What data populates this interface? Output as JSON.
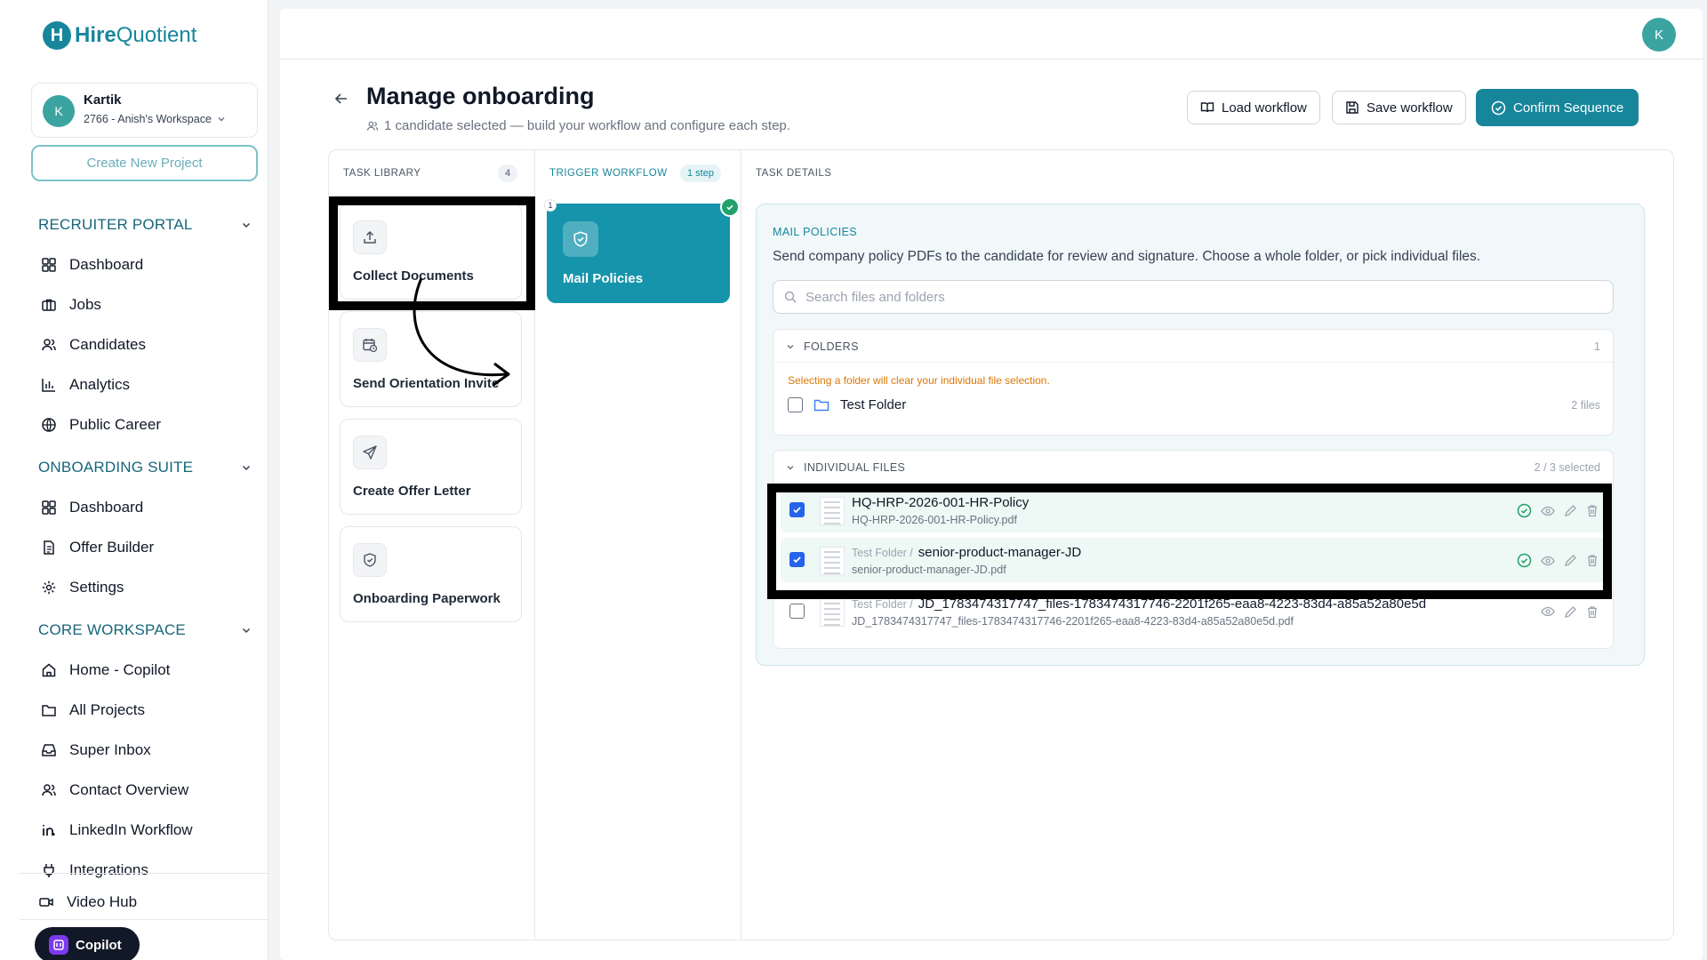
{
  "brand": {
    "logo_letter": "H",
    "name_bold": "Hire",
    "name_light": "Quotient",
    "color": "#17869b"
  },
  "workspace": {
    "avatar": "K",
    "user": "Kartik",
    "name": "2766 - Anish's Workspace"
  },
  "sidebar": {
    "create_project": "Create New Project",
    "sections": [
      {
        "title": "RECRUITER PORTAL",
        "items": [
          "Dashboard",
          "Jobs",
          "Candidates",
          "Analytics",
          "Public Career"
        ]
      },
      {
        "title": "ONBOARDING SUITE",
        "items": [
          "Dashboard",
          "Offer Builder",
          "Settings"
        ]
      },
      {
        "title": "CORE WORKSPACE",
        "items": [
          "Home - Copilot",
          "All Projects",
          "Super Inbox",
          "Contact Overview",
          "LinkedIn Workflow",
          "Integrations"
        ]
      }
    ],
    "video_hub": "Video Hub",
    "copilot": "Copilot"
  },
  "header": {
    "avatar": "K"
  },
  "page": {
    "title": "Manage onboarding",
    "subtitle": "1 candidate selected — build your workflow and configure each step.",
    "load_workflow": "Load workflow",
    "save_workflow": "Save workflow",
    "confirm_sequence": "Confirm Sequence"
  },
  "task_library": {
    "title": "TASK LIBRARY",
    "count": "4",
    "tasks": [
      "Collect Documents",
      "Send Orientation Invite",
      "Create Offer Letter",
      "Onboarding Paperwork"
    ]
  },
  "trigger": {
    "title": "TRIGGER WORKFLOW",
    "steps_badge": "1 step",
    "step_number": "1",
    "step_label": "Mail Policies"
  },
  "details": {
    "title": "TASK DETAILS",
    "panel_title": "MAIL POLICIES",
    "description": "Send company policy PDFs to the candidate for review and signature. Choose a whole folder, or pick individual files.",
    "search_placeholder": "Search files and folders",
    "folders": {
      "title": "FOLDERS",
      "count": "1",
      "warning": "Selecting a folder will clear your individual file selection.",
      "items": [
        {
          "name": "Test Folder",
          "meta": "2 files",
          "checked": false
        }
      ]
    },
    "files": {
      "title": "INDIVIDUAL FILES",
      "count": "2 / 3 selected",
      "items": [
        {
          "folder": "",
          "name": "HQ-HRP-2026-001-HR-Policy",
          "file": "HQ-HRP-2026-001-HR-Policy.pdf",
          "checked": true
        },
        {
          "folder": "Test Folder /",
          "name": "senior-product-manager-JD",
          "file": "senior-product-manager-JD.pdf",
          "checked": true
        },
        {
          "folder": "Test Folder /",
          "name": "JD_1783474317747_files-1783474317746-2201f265-eaa8-4223-83d4-a85a52a80e5d",
          "file": "JD_1783474317747_files-1783474317746-2201f265-eaa8-4223-83d4-a85a52a80e5d.pdf",
          "checked": false
        }
      ]
    }
  }
}
